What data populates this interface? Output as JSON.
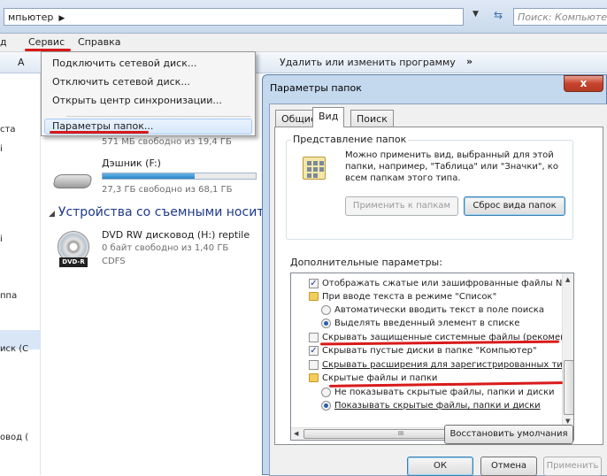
{
  "address": {
    "path": "мпьютер",
    "search_placeholder": "Поиск: Компьютер"
  },
  "menu": {
    "view_partial": "д",
    "service": "Сервис",
    "help": "Справка"
  },
  "toolbar": {
    "left_partial": "А",
    "uninstall": "Удалить или изменить программу",
    "more": "»"
  },
  "nav": {
    "items": [
      "ста",
      "і",
      "і",
      "ппа",
      "иск (C",
      "овод ("
    ]
  },
  "drives": {
    "top_free": "571 МБ свободно из 19,4 ГБ",
    "f_name": "Дэшник (F:)",
    "f_free": "27,3 ГБ свободно из 68,1 ГБ",
    "f_fill": 0.6,
    "removable_header": "Устройства со съемными носите",
    "dvd_name": "DVD RW дисковод (H:) reptile",
    "dvd_free": "0 байт свободно из 1,40 ГБ",
    "dvd_fs": "CDFS",
    "dvd_badge": "DVD-R"
  },
  "service_menu": {
    "items": [
      "Подключить сетевой диск...",
      "Отключить сетевой диск...",
      "Открыть центр синхронизации...",
      "Параметры папок..."
    ]
  },
  "dialog": {
    "title": "Параметры папок",
    "close": "x",
    "tabs": [
      "Общие",
      "Вид",
      "Поиск"
    ],
    "folder_views_legend": "Представление папок",
    "folder_views_desc": "Можно применить вид, выбранный для этой папки, например, \"Таблица\" или \"Значки\", ко всем папкам этого типа.",
    "apply_btn": "Применить к папкам",
    "reset_btn": "Сброс вида папок",
    "advanced_label": "Дополнительные параметры:",
    "settings": [
      "Отображать сжатые или зашифрованные файлы NTI",
      "При вводе текста в режиме \"Список\"",
      "Автоматически вводить текст в поле поиска",
      "Выделять введенный элемент в списке",
      "Скрывать защищенные системные файлы (рекомен,",
      "Скрывать пустые диски в папке \"Компьютер\"",
      "Скрывать расширения для зарегистрированных типо",
      "Скрытые файлы и папки",
      "Не показывать скрытые файлы, папки и диски",
      "Показывать скрытые файлы, папки и диски"
    ],
    "scroll_h_mark": "III",
    "restore_btn": "Восстановить умолчания",
    "ok_btn": "ОК",
    "cancel_btn": "Отмена",
    "apply_footer_btn": "Применить"
  },
  "colors": {
    "annotation_red": "#d91a1a",
    "dialog_frame": "#c4d8ee",
    "close_button": "#c7432c"
  }
}
